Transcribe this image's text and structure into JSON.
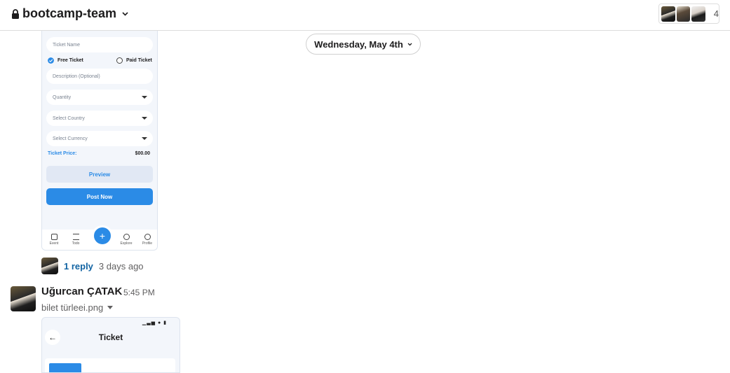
{
  "header": {
    "channel_name": "bootcamp-team",
    "member_count": "4"
  },
  "date_divider": {
    "label": "Wednesday, May 4th"
  },
  "mockup_form": {
    "ticket_name_placeholder": "Ticket Name",
    "free_ticket": "Free Ticket",
    "paid_ticket": "Paid Ticket",
    "description_placeholder": "Description (Optional)",
    "quantity_placeholder": "Quantity",
    "country_placeholder": "Select Country",
    "currency_placeholder": "Select Currency",
    "price_label": "Ticket Price:",
    "price_value": "$00.00",
    "preview_label": "Preview",
    "post_label": "Post Now",
    "tabs": [
      "Event",
      "Todo",
      "Explore",
      "Profile"
    ],
    "fab_symbol": "+"
  },
  "thread": {
    "reply_text": "1 reply",
    "reply_time": "3 days ago"
  },
  "message": {
    "author": "Uğurcan ÇATAK",
    "time": "5:45 PM",
    "file_name": "bilet türleei.png"
  },
  "mockup_ticket": {
    "status_icons": "▁▃▅ ● ▮",
    "back_symbol": "←",
    "title": "Ticket"
  },
  "colors": {
    "accent": "#2b8be6",
    "link": "#1264a3"
  }
}
